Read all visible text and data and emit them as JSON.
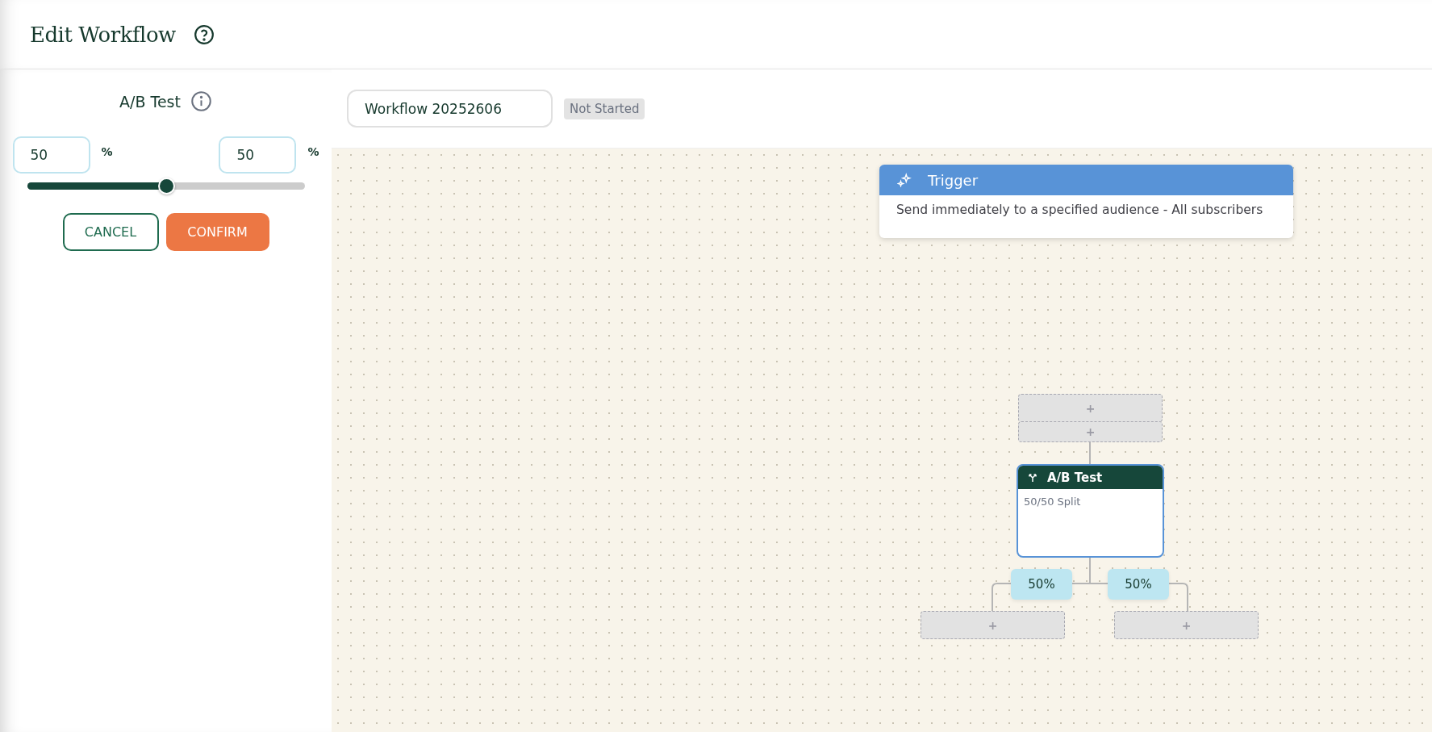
{
  "header": {
    "title": "Edit Workflow"
  },
  "panel": {
    "title": "A/B Test",
    "split": [
      {
        "value": "50",
        "unit": "%"
      },
      {
        "value": "50",
        "unit": "%"
      }
    ],
    "slider": {
      "level": 0.5
    },
    "buttons": [
      {
        "label": "CANCEL",
        "kind": "outline"
      },
      {
        "label": "CONFIRM",
        "kind": "primary"
      }
    ]
  },
  "workflow": {
    "name": "Workflow 20252606",
    "status": "Not Started"
  },
  "canvas": {
    "trigger": {
      "title": "Trigger",
      "description": "Send immediately to a specified audience - All subscribers"
    },
    "top_slot": [
      "+",
      "+"
    ],
    "node": {
      "title": "A/B Test",
      "subtitle": "50/50 Split",
      "selected": true
    },
    "branches": [
      {
        "label": "50%",
        "plus": "+"
      },
      {
        "label": "50%",
        "plus": "+"
      }
    ]
  }
}
